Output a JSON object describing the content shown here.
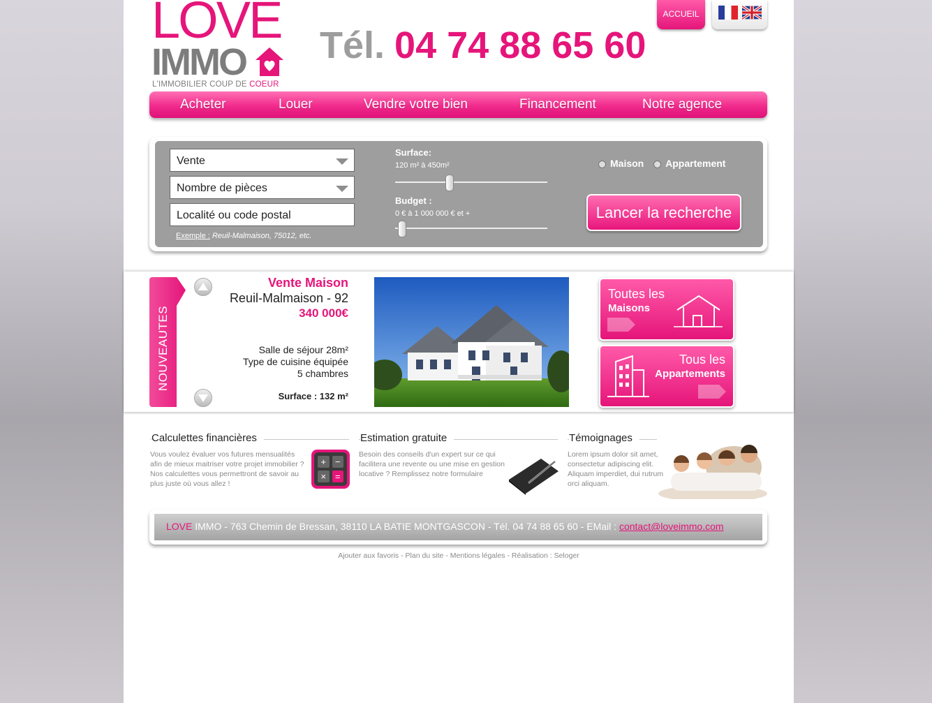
{
  "header": {
    "logo": {
      "love": "LOVE",
      "immo": "IMMO",
      "tagline_prefix": "L'IMMOBILIER COUP DE ",
      "tagline_accent": "COEUR"
    },
    "phone_label": "Tél.",
    "phone_number": "04 74 88 65 60",
    "home_tab": "ACCUEIL",
    "flags": [
      "french-flag-icon",
      "uk-flag-icon"
    ]
  },
  "nav": {
    "items": [
      {
        "label": "Acheter"
      },
      {
        "label": "Louer"
      },
      {
        "label": "Vendre votre bien"
      },
      {
        "label": "Financement"
      },
      {
        "label": "Notre agence"
      }
    ]
  },
  "search": {
    "transaction": "Vente",
    "rooms": "Nombre de pièces",
    "location_placeholder": "Localité ou code postal",
    "example_label": "Exemple :",
    "example_text": " Reuil-Malmaison, 75012, etc.",
    "surface": {
      "label": "Surface:",
      "range": "120 m² à 450m²",
      "level": 0.35
    },
    "budget": {
      "label": "Budget :",
      "range": "0 € à 1 000 000 € et +",
      "level": 0.02
    },
    "types": [
      "Maison",
      "Appartement"
    ],
    "submit_label": "Lancer la recherche"
  },
  "featured": {
    "tab_label": "NOUVEAUTES",
    "title": "Vente Maison",
    "city": "Reuil-Malmaison - 92",
    "price": "340 000€",
    "features": [
      "Salle de séjour 28m²",
      "Type de cuisine équipée",
      "5 chambres"
    ],
    "surface": "Surface : 132 m²"
  },
  "categories": [
    {
      "line1": "Toutes les",
      "line2": "Maisons"
    },
    {
      "line1": "Tous les",
      "line2": "Appartements"
    }
  ],
  "info_blocks": [
    {
      "title": "Calculettes financières",
      "text": "Vous voulez évaluer vos futures mensualités afin de mieux maitriser votre projet immobilier ? Nos calculettes vous permettront de savoir au plus juste où vous allez !",
      "icon": "calculator-icon"
    },
    {
      "title": "Estimation gratuite",
      "text": "Besoin des conseils d'un expert sur ce qui facilitera une revente ou une mise en gestion locative ? Remplissez notre formulaire",
      "icon": "notebook-pen-icon"
    },
    {
      "title": "Témoignages",
      "text": "Lorem ipsum dolor sit amet, consectetur adipiscing elit. Aliquam imperdiet, dui rutrum orci aliquam.",
      "icon": "family-photo"
    }
  ],
  "calculator_keys": [
    "+",
    "−",
    "×",
    "="
  ],
  "footer": {
    "brand_love": "LOVE",
    "address": " IMMO - 763 Chemin de Bressan, 38110 LA BATIE MONTGASCON - Tél. 04 74 88 65 60 - EMail : ",
    "email": "contact@loveimmo.com"
  },
  "links": [
    "Ajouter aux favoris",
    "Plan du site",
    "Mentions légales",
    "Réalisation : Seloger"
  ],
  "colors": {
    "brand_pink": "#e5157a",
    "grey": "#9f9e9f"
  }
}
